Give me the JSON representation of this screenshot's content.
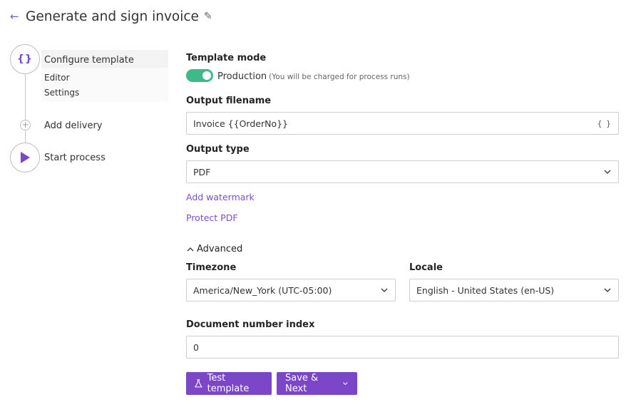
{
  "header": {
    "back_icon": "arrow-left-icon",
    "title": "Generate and sign invoice",
    "edit_icon": "pencil-icon"
  },
  "stepper": {
    "steps": [
      {
        "label": "Configure template",
        "icon": "curly-braces-icon",
        "active": true,
        "substeps": [
          "Editor",
          "Settings"
        ]
      },
      {
        "label": "Add delivery",
        "icon": "plus-icon"
      },
      {
        "label": "Start process",
        "icon": "play-icon"
      }
    ]
  },
  "form": {
    "template_mode": {
      "label": "Template mode",
      "toggle_on": true,
      "value": "Production",
      "hint": "(You will be charged for process runs)"
    },
    "output_filename": {
      "label": "Output filename",
      "value": "Invoice {{OrderNo}}",
      "icon": "curly-braces-icon"
    },
    "output_type": {
      "label": "Output type",
      "value": "PDF"
    },
    "links": {
      "add_watermark": "Add watermark",
      "protect_pdf": "Protect PDF"
    },
    "advanced": {
      "label": "Advanced",
      "expanded": true
    },
    "timezone": {
      "label": "Timezone",
      "value": "America/New_York (UTC-05:00)"
    },
    "locale": {
      "label": "Locale",
      "value": "English - United States (en-US)"
    },
    "document_number_index": {
      "label": "Document number index",
      "value": "0"
    }
  },
  "actions": {
    "test_template": "Test template",
    "save_next": "Save & Next"
  },
  "colors": {
    "accent": "#7b46c8",
    "toggle_on": "#3fb88a",
    "link": "#7a4fc9"
  }
}
